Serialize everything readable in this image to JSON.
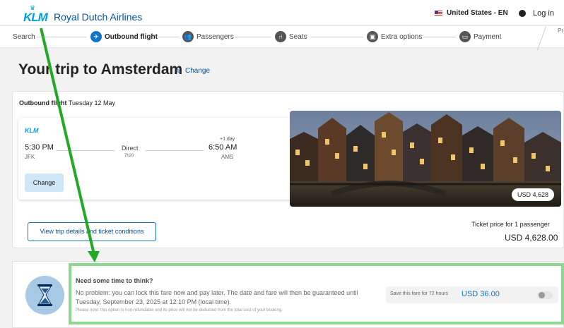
{
  "header": {
    "brand_logo": "KLM",
    "brand_name": "Royal Dutch Airlines",
    "locale": "United States - EN",
    "login_label": "Log in"
  },
  "stepper": {
    "steps": [
      {
        "label": "Search",
        "active": false
      },
      {
        "label": "Outbound flight",
        "active": true
      },
      {
        "label": "Passengers",
        "active": false
      },
      {
        "label": "Seats",
        "active": false
      },
      {
        "label": "Extra options",
        "active": false
      },
      {
        "label": "Payment",
        "active": false
      }
    ],
    "truncated_label": "Pr"
  },
  "page": {
    "title": "Your trip to Amsterdam",
    "change_label": "Change"
  },
  "outbound": {
    "heading_bold": "Outbound flight",
    "heading_date": "Tuesday 12 May",
    "airline_logo": "KLM",
    "departure_time": "5:30 PM",
    "departure_code": "JFK",
    "stop_type": "Direct",
    "duration": "7h20",
    "arrival_day_offset": "+1 day",
    "arrival_time": "6:50 AM",
    "arrival_code": "AMS",
    "change_button": "Change",
    "image_price_badge": "USD 4,628"
  },
  "pricing": {
    "view_details_label": "View trip details and ticket conditions",
    "ticket_price_label": "Ticket price for 1 passenger",
    "total": "USD 4,628.00"
  },
  "hold_fare": {
    "title": "Need some time to think?",
    "text": "No problem: you can lock this fare now and pay later. The date and fare will then be guaranteed until Tuesday, September 23, 2025 at 12:10 PM (local time).",
    "note": "Please note: this option is non-refundable and its price will not be deducted from the total cost of your booking.",
    "save_label": "Save this fare for 72 hours",
    "save_price": "USD 36.00",
    "toggle_on": false
  },
  "colors": {
    "brand": "#00a1de",
    "link": "#00529c",
    "accent": "#1174c7",
    "annotation_arrow": "#22aa22",
    "highlight_border": "#8cd88c"
  }
}
